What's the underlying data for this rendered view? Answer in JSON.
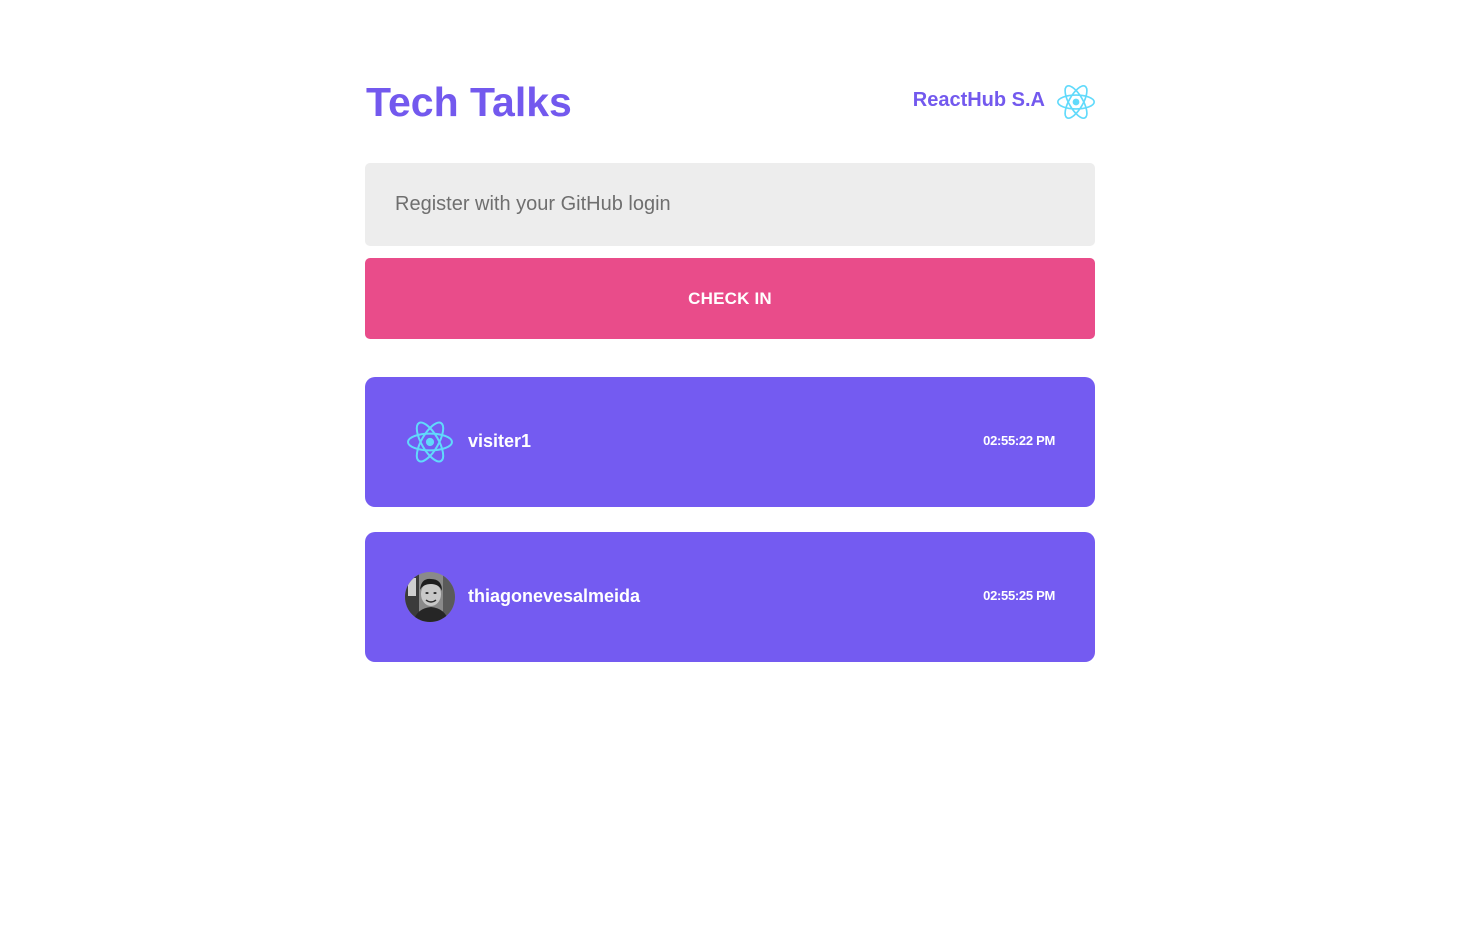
{
  "header": {
    "title": "Tech Talks",
    "company": "ReactHub S.A",
    "logo_icon": "react-logo-icon"
  },
  "form": {
    "placeholder": "Register with your GitHub login",
    "value": "",
    "button_label": "CHECK IN"
  },
  "checkins": [
    {
      "name": "visiter1",
      "time": "02:55:22 PM",
      "avatar": "react-logo-icon"
    },
    {
      "name": "thiagonevesalmeida",
      "time": "02:55:25 PM",
      "avatar": "user-photo"
    }
  ],
  "colors": {
    "primary": "#7359ee",
    "card": "#745bf1",
    "button": "#e94c8a",
    "input_bg": "#ededed",
    "react_cyan": "#61dafb"
  }
}
